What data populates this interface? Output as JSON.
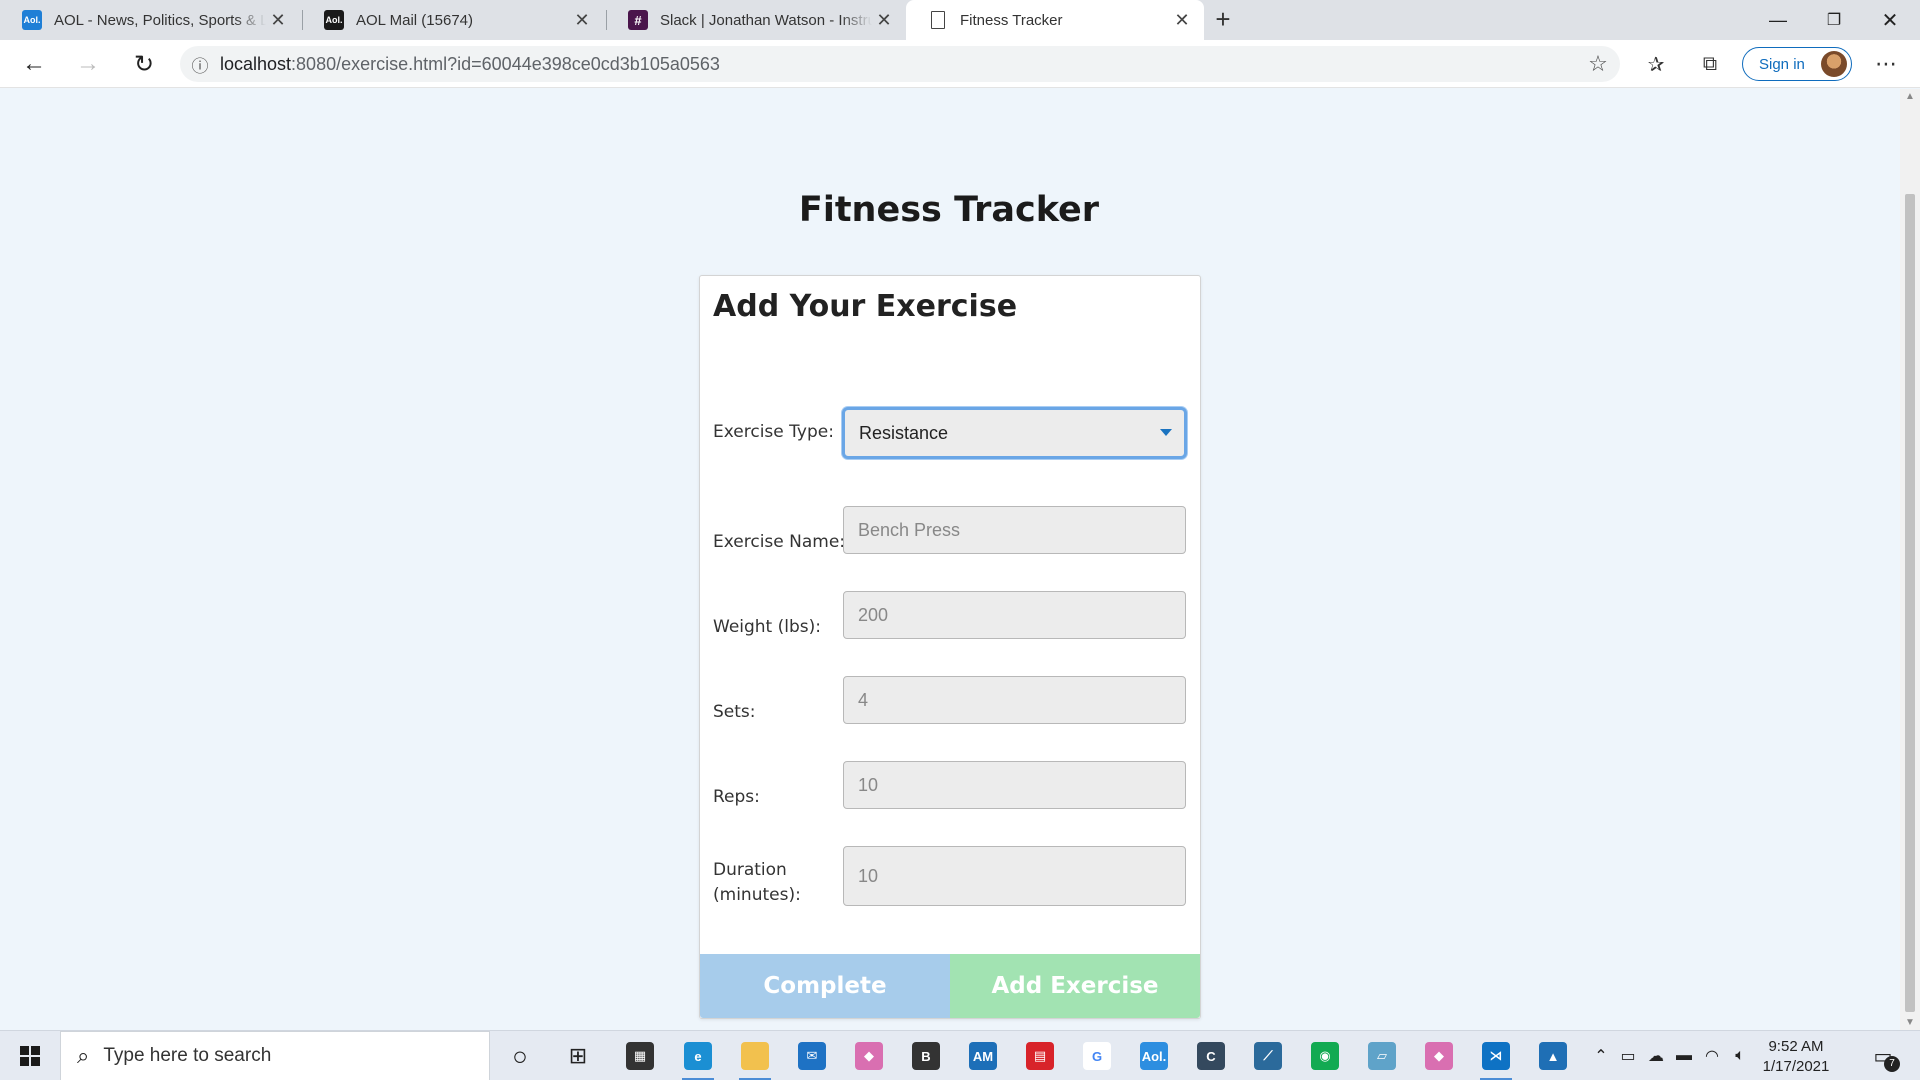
{
  "browser": {
    "tabs": [
      {
        "title": "AOL - News, Politics, Sports & La",
        "icon": "aol-icon",
        "favicon_text": "Aol.",
        "color": "#1f7fd6"
      },
      {
        "title": "AOL Mail (15674)",
        "icon": "aol-mail-icon",
        "favicon_text": "Aol.",
        "color": "#1a1a1a"
      },
      {
        "title": "Slack | Jonathan Watson - Instruc",
        "icon": "slack-icon",
        "favicon_text": "#",
        "color": "#4a154b"
      },
      {
        "title": "Fitness Tracker",
        "icon": "page-icon",
        "favicon_text": "",
        "color": "#ffffff",
        "active": true
      }
    ],
    "address": {
      "host": "localhost",
      "path": ":8080/exercise.html?id=60044e398ce0cd3b105a0563"
    },
    "sign_in_label": "Sign in"
  },
  "page": {
    "title": "Fitness Tracker",
    "card_title": "Add Your Exercise",
    "exercise_type": {
      "label": "Exercise Type:",
      "value": "Resistance"
    },
    "exercise_name": {
      "label": "Exercise Name:",
      "placeholder": "Bench Press"
    },
    "weight": {
      "label": "Weight (lbs):",
      "placeholder": "200"
    },
    "sets": {
      "label": "Sets:",
      "placeholder": "4"
    },
    "reps": {
      "label": "Reps:",
      "placeholder": "10"
    },
    "duration": {
      "label": "Duration (minutes):",
      "placeholder": "10"
    },
    "buttons": {
      "complete": "Complete",
      "add": "Add Exercise"
    },
    "colors": {
      "complete": "#a7cceb",
      "add": "#a2e3b2",
      "focus": "#6aa6e6"
    }
  },
  "taskbar": {
    "search_placeholder": "Type here to search",
    "time": "9:52 AM",
    "date": "1/17/2021",
    "notification_count": "7",
    "apps": [
      {
        "name": "edge-icon",
        "text": "e",
        "color": "#1b8fd3"
      },
      {
        "name": "file-explorer-icon",
        "text": "",
        "color": "#f2c14e"
      },
      {
        "name": "mail-icon",
        "text": "✉",
        "color": "#1e72c4"
      },
      {
        "name": "gitkraken-icon",
        "text": "◆",
        "color": "#d96fb1"
      },
      {
        "name": "b-app-icon",
        "text": "B",
        "color": "#333333"
      },
      {
        "name": "amex-icon",
        "text": "AM",
        "color": "#1d6fb8"
      },
      {
        "name": "red-app-icon",
        "text": "▤",
        "color": "#d8232a"
      },
      {
        "name": "google-icon",
        "text": "G",
        "color": "#ffffff"
      },
      {
        "name": "aol-app-icon",
        "text": "Aol.",
        "color": "#2d8ee0"
      },
      {
        "name": "c-app-icon",
        "text": "C",
        "color": "#34495e"
      },
      {
        "name": "mysql-icon",
        "text": "⟋",
        "color": "#2b6a9b"
      },
      {
        "name": "mongodb-compass-icon",
        "text": "◉",
        "color": "#13aa52"
      },
      {
        "name": "notepad-icon",
        "text": "▱",
        "color": "#5fa3c9"
      },
      {
        "name": "gitkraken-2-icon",
        "text": "◆",
        "color": "#d96fb1"
      },
      {
        "name": "vscode-icon",
        "text": "⋊",
        "color": "#0e72c4"
      },
      {
        "name": "photos-icon",
        "text": "▲",
        "color": "#1f6fb5"
      }
    ]
  }
}
